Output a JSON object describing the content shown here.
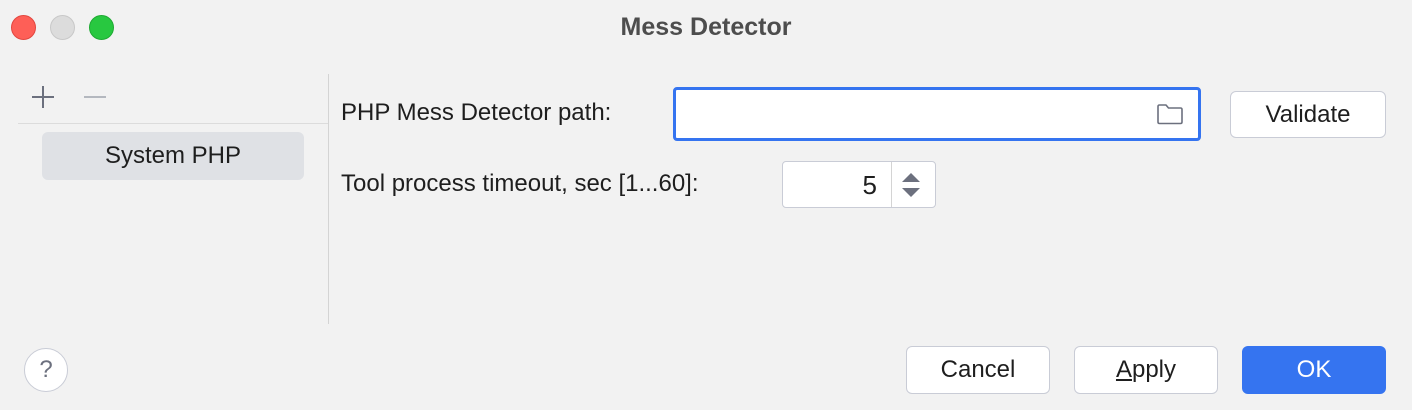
{
  "window": {
    "title": "Mess Detector"
  },
  "sidebar": {
    "add_icon": "plus-icon",
    "remove_icon": "minus-icon",
    "items": [
      {
        "label": "System PHP",
        "selected": true
      }
    ]
  },
  "form": {
    "path_label": "PHP Mess Detector path:",
    "path_value": "",
    "path_browse_icon": "folder-icon",
    "validate_label": "Validate",
    "timeout_label": "Tool process timeout, sec [1...60]:",
    "timeout_value": "5"
  },
  "footer": {
    "help_label": "?",
    "cancel_label": "Cancel",
    "apply_mnemonic": "A",
    "apply_rest": "pply",
    "ok_label": "OK"
  },
  "colors": {
    "accent": "#3574f0",
    "close": "#fe5f57",
    "minimize": "#dcdcdc",
    "maximize": "#28c840",
    "selection": "#dfe1e5"
  }
}
